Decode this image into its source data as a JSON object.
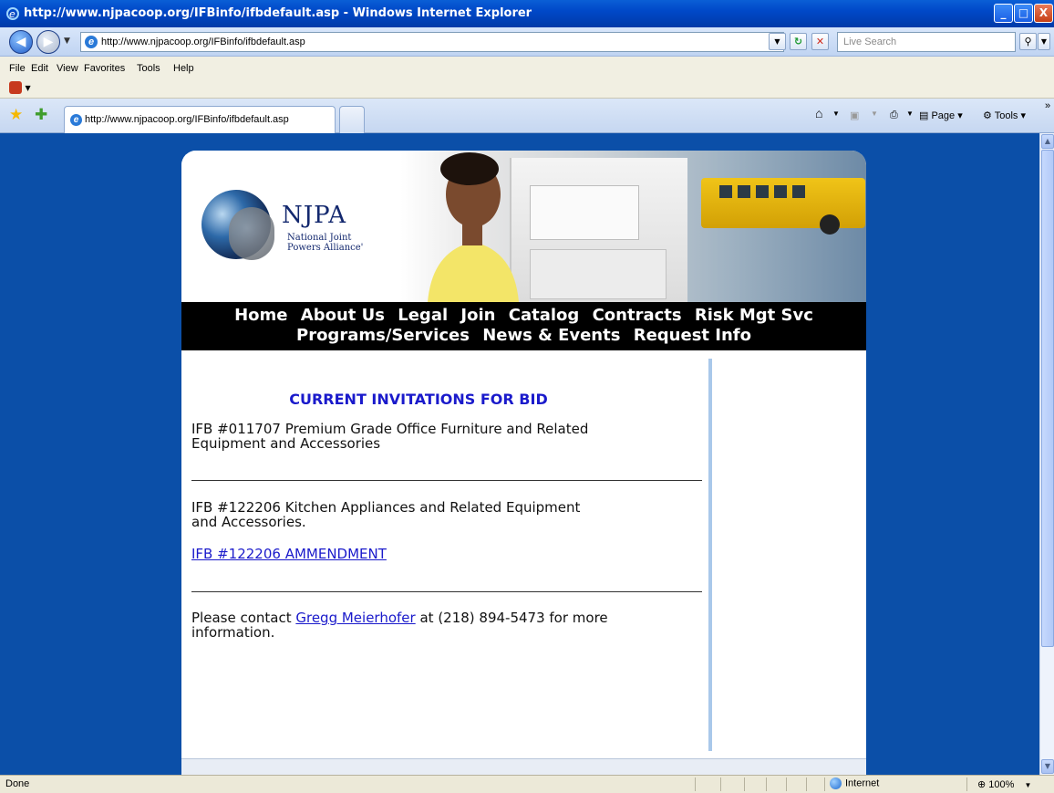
{
  "window": {
    "title": "http://www.njpacoop.org/IFBinfo/ifbdefault.asp - Windows Internet Explorer",
    "minimize": "_",
    "maximize": "□",
    "close": "X"
  },
  "addressbar": {
    "url": "http://www.njpacoop.org/IFBinfo/ifbdefault.asp",
    "search_placeholder": "Live Search"
  },
  "menu": {
    "items": [
      "File",
      "Edit",
      "View",
      "Favorites",
      "Tools",
      "Help"
    ]
  },
  "tabs": {
    "active_label": "http://www.njpacoop.org/IFBinfo/ifbdefault.asp"
  },
  "commandbar": {
    "page_label": "Page",
    "tools_label": "Tools"
  },
  "site": {
    "logo_name": "NJPA",
    "logo_sub_line1": "National Joint",
    "logo_sub_line2": "Powers Alliance'",
    "nav_row1": [
      "Home",
      "About Us",
      "Legal",
      "Join",
      "Catalog",
      "Contracts",
      "Risk Mgt Svc"
    ],
    "nav_row2": [
      "Programs/Services",
      "News & Events",
      "Request Info"
    ]
  },
  "content": {
    "heading": "CURRENT INVITATIONS FOR BID",
    "ifb1_line1": "IFB #011707 Premium Grade Office Furniture and Related",
    "ifb1_line2": "Equipment and Accessories",
    "ifb2_line1": "IFB #122206 Kitchen Appliances and Related Equipment",
    "ifb2_line2": "and Accessories.",
    "amendment_link": "IFB #122206 AMMENDMENT",
    "contact_prefix": "Please contact ",
    "contact_name": "Gregg Meierhofer",
    "contact_suffix": " at (218) 894-5473 for more",
    "contact_line2": "information."
  },
  "status": {
    "text": "Done",
    "zone": "Internet",
    "zoom": "100%"
  },
  "colors": {
    "page_background": "#0b4fa8",
    "heading": "#1a1acb",
    "nav_band": "#000000"
  }
}
